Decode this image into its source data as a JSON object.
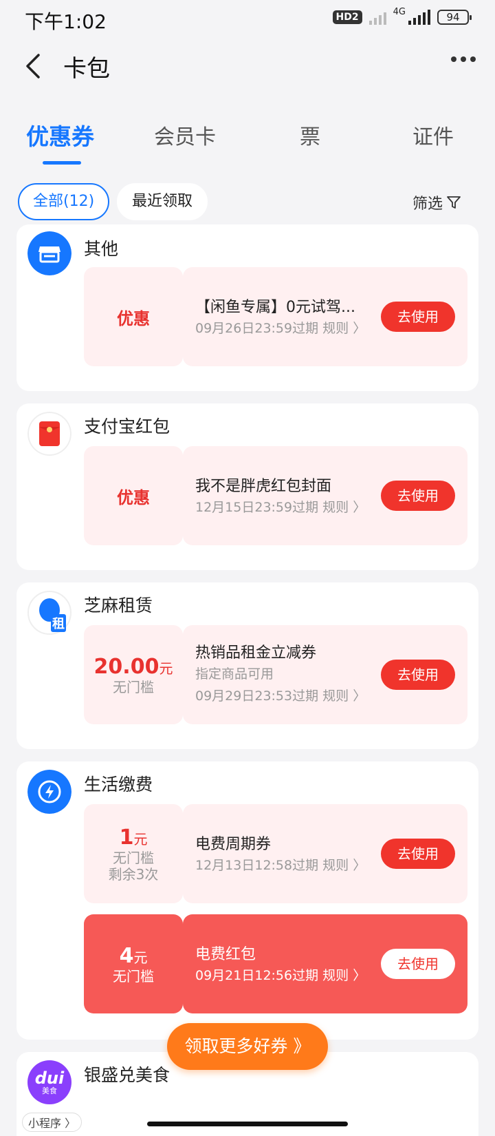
{
  "status_bar": {
    "time": "下午1:02",
    "hd": "HD2",
    "network": "4G",
    "battery": "94"
  },
  "header": {
    "title": "卡包",
    "back_icon": "chevron-left-icon",
    "more_icon": "more-dots-icon"
  },
  "tabs": [
    {
      "label": "优惠券",
      "active": true
    },
    {
      "label": "会员卡",
      "active": false
    },
    {
      "label": "票",
      "active": false
    },
    {
      "label": "证件",
      "active": false
    }
  ],
  "filters": {
    "all": "全部(12)",
    "recent": "最近领取",
    "filter": "筛选"
  },
  "groups": [
    {
      "merchant": "其他",
      "icon": "shop-icon",
      "coupons": [
        {
          "left_main": "优惠",
          "name": "【闲鱼专属】0元试驾...",
          "meta1": "09月26日23:59过期  规则 〉",
          "button": "去使用"
        }
      ]
    },
    {
      "merchant": "支付宝红包",
      "icon": "red-envelope-icon",
      "coupons": [
        {
          "left_main": "优惠",
          "name": "我不是胖虎红包封面",
          "meta1": "12月15日23:59过期  规则 〉",
          "button": "去使用"
        }
      ]
    },
    {
      "merchant": "芝麻租赁",
      "icon": "rent-icon",
      "icon_text": "租",
      "coupons": [
        {
          "amount": "20.00",
          "unit": "元",
          "sub1": "无门槛",
          "name": "热销品租金立减券",
          "meta1": "指定商品可用",
          "meta2": "09月29日23:53过期  规则 〉",
          "button": "去使用"
        }
      ]
    },
    {
      "merchant": "生活缴费",
      "icon": "lightning-icon",
      "coupons": [
        {
          "amount": "1",
          "unit": "元",
          "sub1": "无门槛",
          "sub2": "剩余3次",
          "name": "电费周期券",
          "meta1": "12月13日12:58过期  规则 〉",
          "button": "去使用"
        },
        {
          "amount": "4",
          "unit": "元",
          "sub1": "无门槛",
          "name": "电费红包",
          "meta1": "09月21日12:56过期  规则 〉",
          "button": "去使用",
          "highlight": true
        }
      ]
    },
    {
      "merchant": "银盛兑美食",
      "icon": "dui-logo-icon",
      "icon_text": "dui",
      "icon_sub": "美食",
      "mini_program_tag": "小程序 〉"
    }
  ],
  "fab": {
    "label": "领取更多好券 》"
  }
}
